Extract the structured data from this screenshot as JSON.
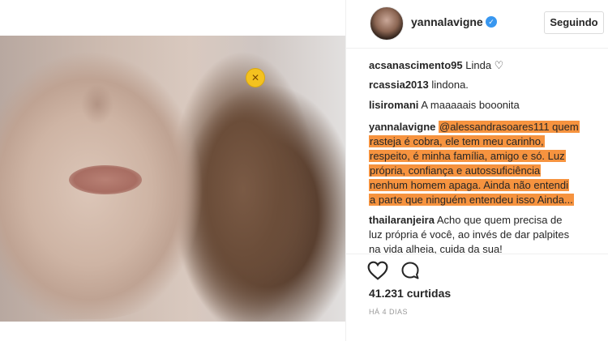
{
  "post": {
    "username": "yannalavigne",
    "follow_label": "Seguindo",
    "likes": "41.231 curtidas",
    "timestamp": "HÁ 4 DIAS"
  },
  "icons": {
    "verified": "verified-badge-icon",
    "like": "heart-icon",
    "comment": "comment-bubble-icon",
    "sticker": "emoji-sticker-icon"
  },
  "colors": {
    "highlight": "#f6933f",
    "verified": "#3897f0",
    "timestamp": "#999999"
  },
  "comments": [
    {
      "author": "acsanascimento95",
      "text": "Linda ♡"
    },
    {
      "author": "rcassia2013",
      "text": "lindona."
    },
    {
      "author": "lisiromani",
      "text": "A maaaaais booonita"
    },
    {
      "author": "yannalavigne",
      "lines": [
        "@alessandrasoares111 quem",
        "rasteja é cobra, ele tem meu carinho,",
        "respeito, é minha família, amigo e só. Luz",
        "própria, confiança e autossuficiência",
        "nenhum homem apaga. Ainda não entendi",
        "a parte que ninguém entendeu isso Ainda..."
      ]
    },
    {
      "author": "thailaranjeira",
      "lines": [
        "Acho que quem precisa de",
        "luz própria é você, ao invés de dar palpites",
        "na vida alheia, cuida da sua!"
      ]
    }
  ]
}
